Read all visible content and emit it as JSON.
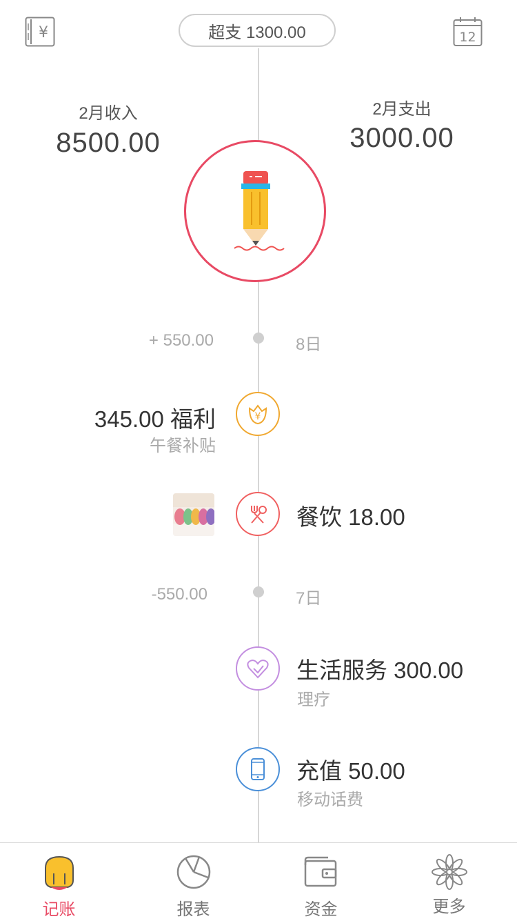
{
  "header": {
    "overspend_label": "超支 1300.00"
  },
  "summary": {
    "income_label": "2月收入",
    "income_value": "8500.00",
    "expense_label": "2月支出",
    "expense_value": "3000.00"
  },
  "timeline": {
    "day1": {
      "amount": "+ 550.00",
      "label": "8日"
    },
    "entry_welfare": {
      "main": "345.00 福利",
      "sub": "午餐补贴",
      "color": "#f0a830"
    },
    "entry_food": {
      "main": "餐饮 18.00",
      "color": "#f06060"
    },
    "day2": {
      "amount": "-550.00",
      "label": "7日"
    },
    "entry_life": {
      "main": "生活服务 300.00",
      "sub": "理疗",
      "color": "#c38ee0"
    },
    "entry_recharge": {
      "main": "充值 50.00",
      "sub": "移动话费",
      "color": "#4a8fd8"
    }
  },
  "tabbar": {
    "tabs": [
      {
        "label": "记账",
        "active": true
      },
      {
        "label": "报表",
        "active": false
      },
      {
        "label": "资金",
        "active": false
      },
      {
        "label": "更多",
        "active": false
      }
    ],
    "active_color": "#e84a64"
  }
}
